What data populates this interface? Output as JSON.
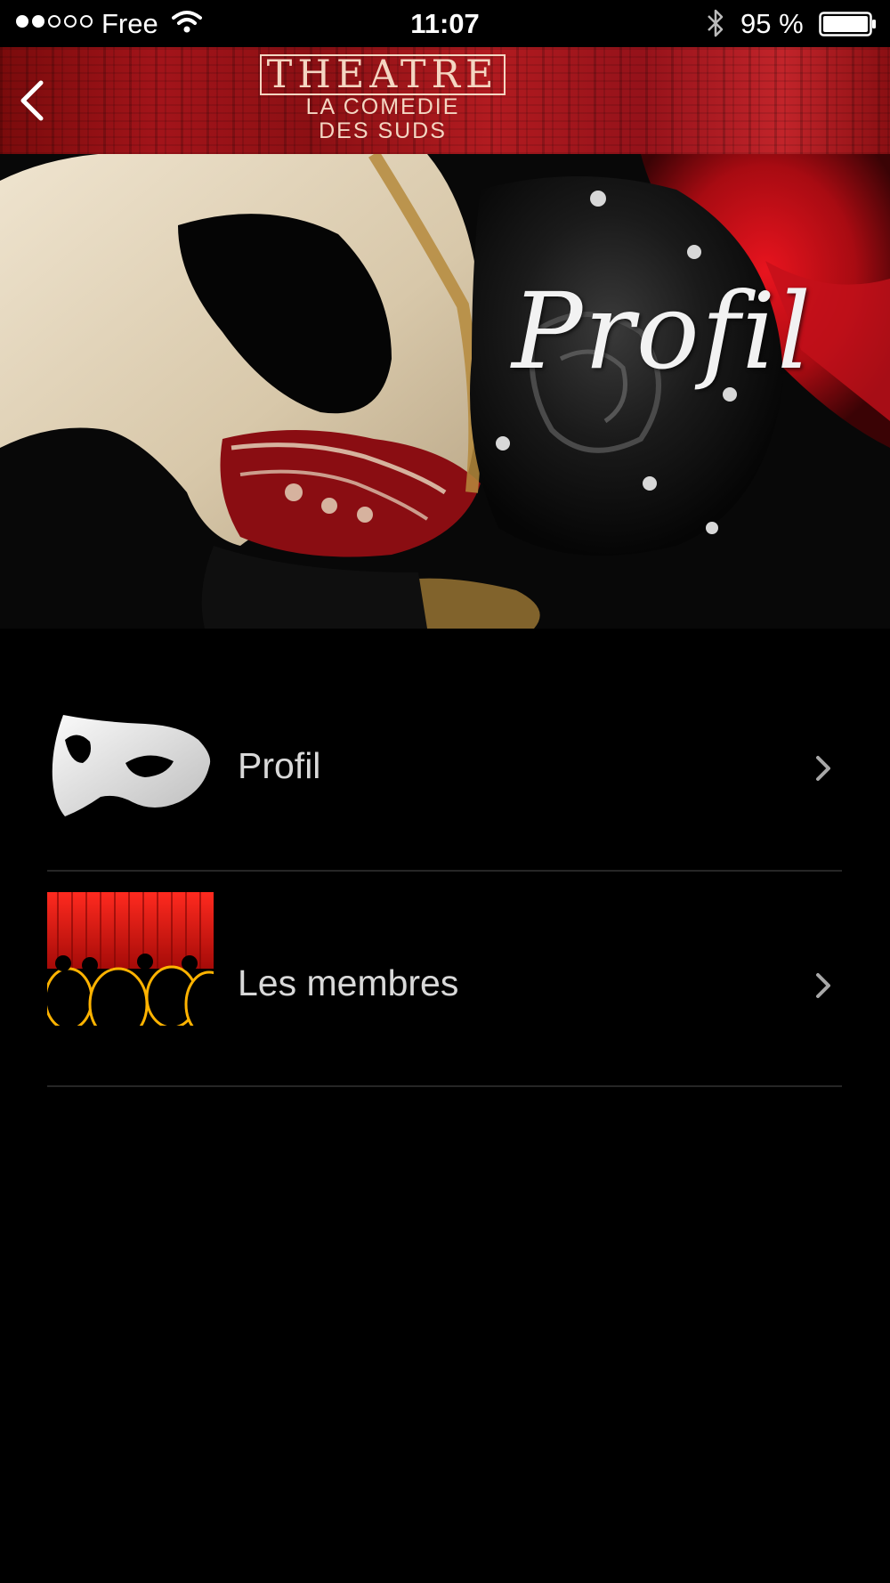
{
  "status_bar": {
    "carrier": "Free",
    "time": "11:07",
    "battery": "95 %",
    "signal_dots_filled": 2,
    "signal_dots_total": 5
  },
  "header": {
    "logo_title": "THEATRE",
    "logo_line1": "LA COMEDIE",
    "logo_line2": "DES SUDS",
    "back_icon": "chevron-left-icon"
  },
  "hero": {
    "title": "Profil"
  },
  "menu": {
    "items": [
      {
        "label": "Profil",
        "thumb": "white-mask"
      },
      {
        "label": "Les membres",
        "thumb": "red-curtain-audience"
      }
    ],
    "chevron_icon": "chevron-right-icon"
  },
  "colors": {
    "background": "#000000",
    "header_red": "#a3141a",
    "logo_text": "#f4d6c2",
    "menu_text": "#d9d9d9",
    "divider": "#262626"
  }
}
